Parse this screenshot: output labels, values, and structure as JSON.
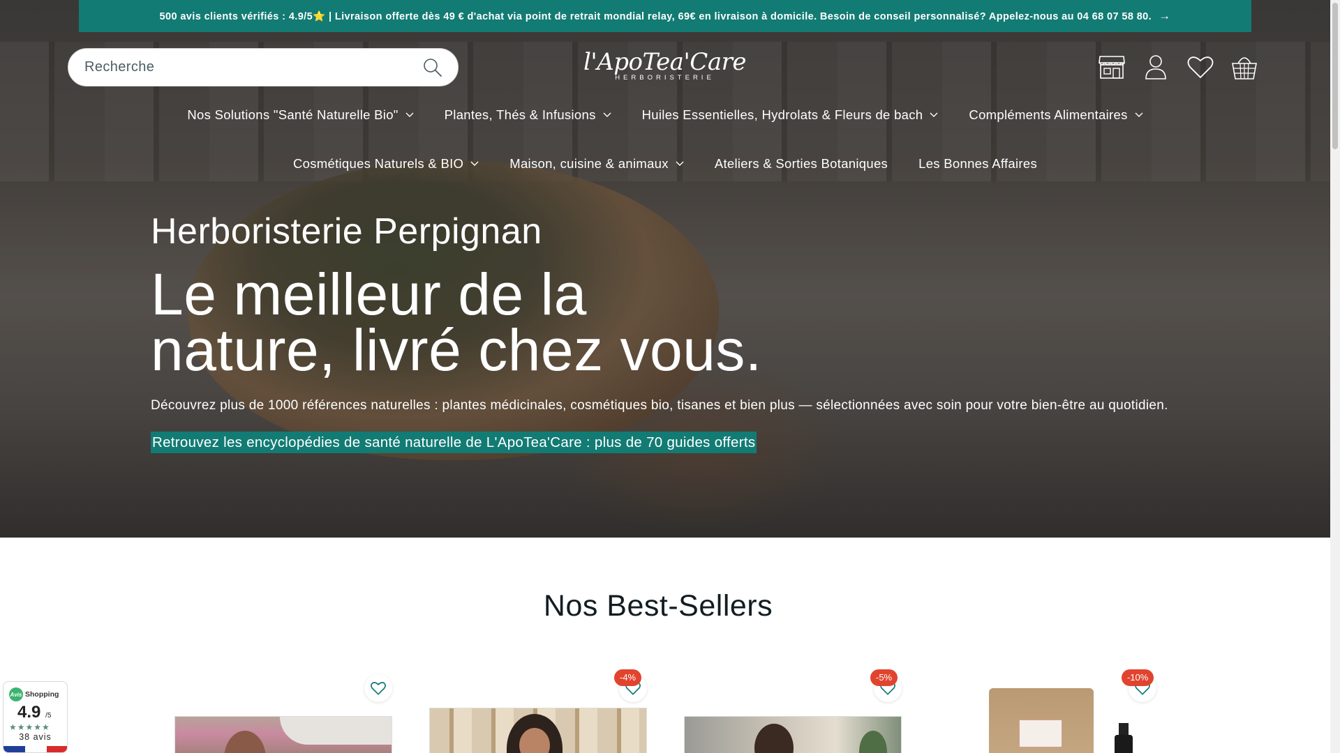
{
  "announcement": {
    "text": "500 avis clients vérifiés : 4.9/5⭐ | Livraison offerte dès 49 € d'achat via point de retrait mondial relay, 69€ en livraison à domicile. Besoin de conseil personnalisé? Appelez-nous au 04 68 07 58 80.",
    "arrow": "→"
  },
  "search": {
    "placeholder": "Recherche"
  },
  "logo": {
    "main": "l'ApoTea'Care",
    "sub": "HERBORISTERIE"
  },
  "header_icons": [
    "store-icon",
    "account-icon",
    "wishlist-icon",
    "basket-icon"
  ],
  "nav": {
    "row1": [
      {
        "label": "Nos Solutions \"Santé Naturelle Bio\"",
        "dropdown": true
      },
      {
        "label": "Plantes, Thés & Infusions",
        "dropdown": true
      },
      {
        "label": "Huiles Essentielles, Hydrolats & Fleurs de bach",
        "dropdown": true
      },
      {
        "label": "Compléments Alimentaires",
        "dropdown": true
      }
    ],
    "row2": [
      {
        "label": "Cosmétiques Naturels & BIO",
        "dropdown": true
      },
      {
        "label": "Maison, cuisine & animaux",
        "dropdown": true
      },
      {
        "label": "Ateliers & Sorties Botaniques",
        "dropdown": false
      },
      {
        "label": "Les Bonnes Affaires",
        "dropdown": false
      }
    ]
  },
  "hero": {
    "eyebrow": "Herboristerie Perpignan",
    "headline_line1": "Le meilleur de la",
    "headline_line2": "nature, livré chez vous.",
    "description": "Découvrez plus de 1000 références naturelles : plantes médicinales, cosmétiques bio, tisanes et bien plus — sélectionnées avec soin pour votre bien-être au quotidien.",
    "cta": "Retrouvez les encyclopédies de santé naturelle de L'ApoTea'Care : plus de 70 guides offerts"
  },
  "best_sellers": {
    "title": "Nos Best-Sellers",
    "products": [
      {
        "badge": ""
      },
      {
        "badge": "-4%"
      },
      {
        "badge": "-5%"
      },
      {
        "badge": "-10%"
      }
    ]
  },
  "review_widget": {
    "brand": "Shopping",
    "score": "4.9",
    "scale": "/5",
    "stars": "★★★★★",
    "count": "38 avis"
  },
  "colors": {
    "accent": "#127b74",
    "discount": "#e1442e",
    "heading": "#121d22"
  }
}
